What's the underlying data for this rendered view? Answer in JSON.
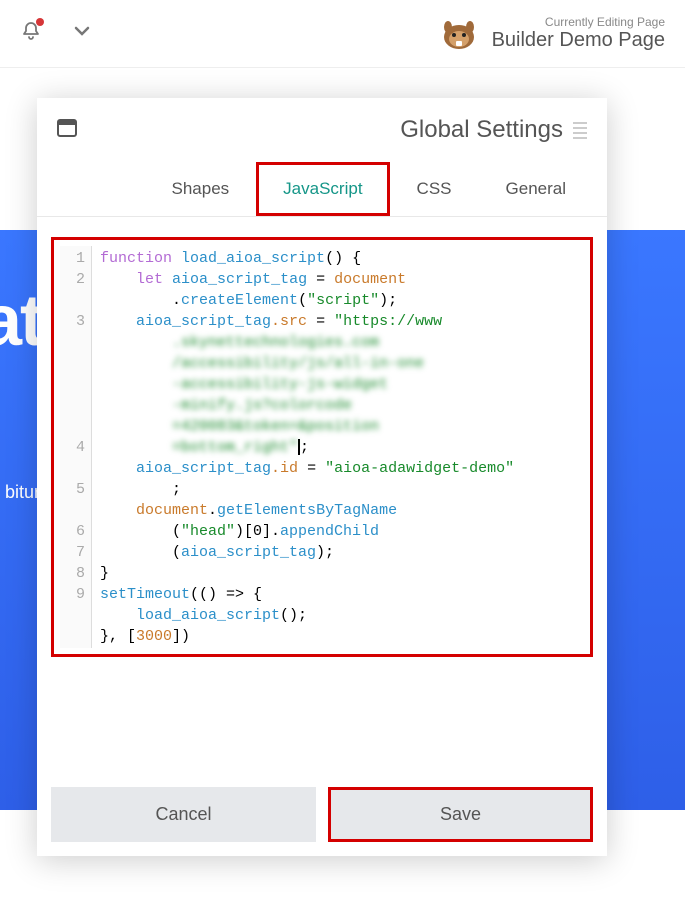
{
  "header": {
    "subtitle": "Currently Editing Page",
    "title": "Builder Demo Page"
  },
  "hero": {
    "heading": "nate",
    "sub": "bitur arcu"
  },
  "modal": {
    "title": "Global Settings",
    "tabs": {
      "general": "General",
      "css": "CSS",
      "javascript": "JavaScript",
      "shapes": "Shapes"
    },
    "code": {
      "lines": [
        "1",
        "2",
        "3",
        "4",
        "5",
        "6",
        "7",
        "8",
        "9"
      ],
      "l1_kw": "function",
      "l1_fn": "load_aioa_script",
      "l1_rest": "() {",
      "l2_kw": "let",
      "l2_var": "aioa_script_tag",
      "l2_eq": " = ",
      "l2_doc": "document",
      "l2_cont": ".",
      "l2_create": "createElement",
      "l2_arg": "\"script\"",
      "l2_end": ");",
      "l3_var": "aioa_script_tag",
      "l3_prop": ".src",
      "l3_eq": " = ",
      "l3_str": "\"https://www",
      "l3_b1": ".skynettechnologies.com",
      "l3_b2": "/accessibility/js/all-in-one",
      "l3_b3": "-accessibility-js-widget",
      "l3_b4": "-minify.js?colorcode",
      "l3_b5": "=420083&token=&position",
      "l3_b6": "=bottom_right\"",
      "l3_cur": ";",
      "l4_var": "aioa_script_tag",
      "l4_prop": ".id",
      "l4_eq": " = ",
      "l4_str": "\"aioa-adawidget-demo\"",
      "l4_end": ";",
      "l5_doc": "document",
      "l5_dot": ".",
      "l5_get": "getElementsByTagName",
      "l5_arg": "\"head\"",
      "l5_mid": ")[0].",
      "l5_app": "appendChild",
      "l5_arg2": "aioa_script_tag",
      "l5_end": ");",
      "l6": "}",
      "l7_fn": "setTimeout",
      "l7_rest": "(() => {",
      "l8_fn": "load_aioa_script",
      "l8_rest": "();",
      "l9a": "}, [",
      "l9_num": "3000",
      "l9b": "])"
    },
    "buttons": {
      "save": "Save",
      "cancel": "Cancel"
    }
  }
}
